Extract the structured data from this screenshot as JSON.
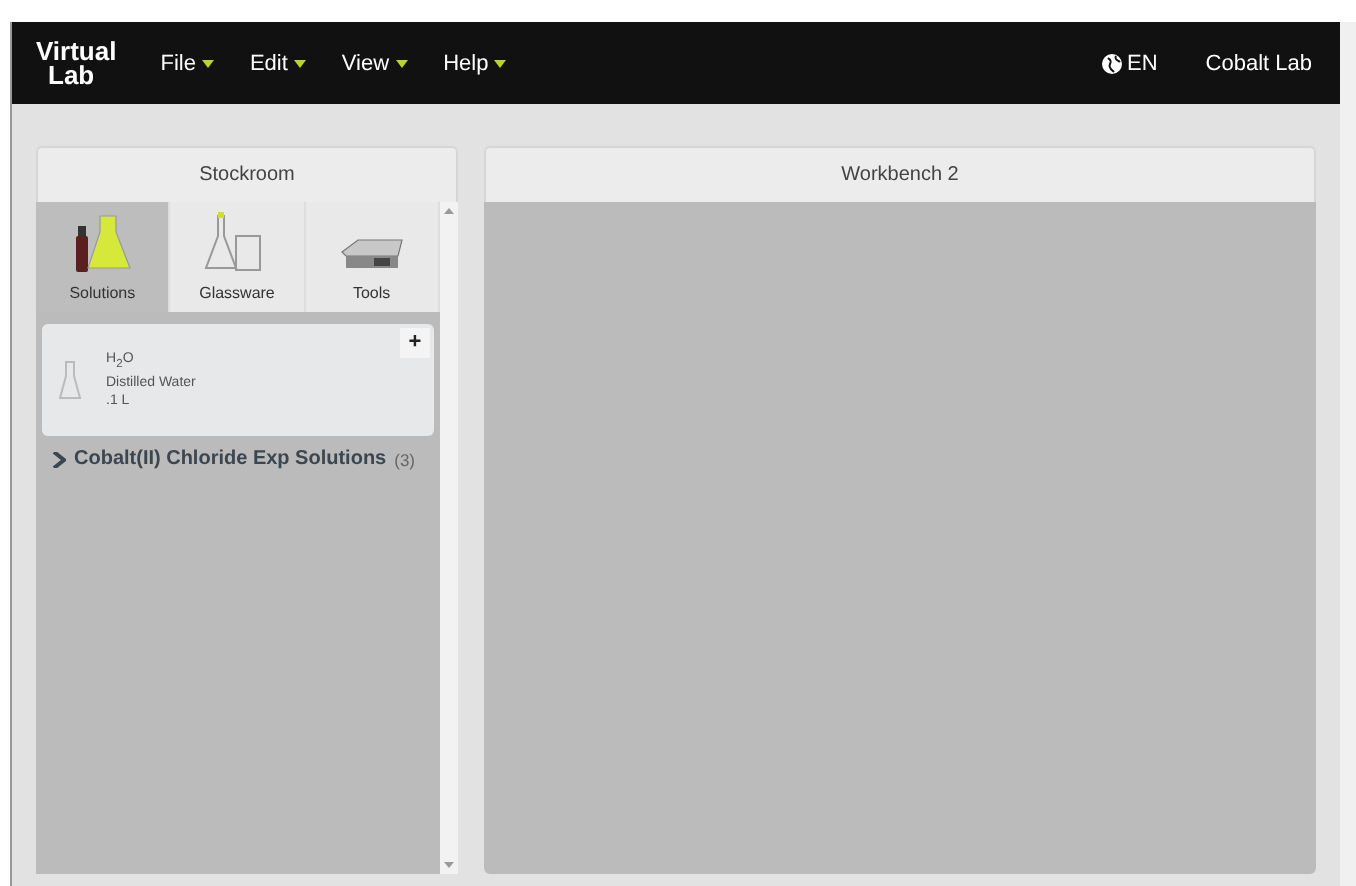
{
  "navbar": {
    "logo": [
      "Virtual",
      "Lab"
    ],
    "menus": [
      {
        "label": "File"
      },
      {
        "label": "Edit"
      },
      {
        "label": "View"
      },
      {
        "label": "Help"
      }
    ],
    "language": "EN",
    "user": "Cobalt Lab"
  },
  "stockroom": {
    "title": "Stockroom",
    "tabs": [
      {
        "label": "Solutions",
        "kind": "solutions",
        "selected": true
      },
      {
        "label": "Glassware",
        "kind": "glassware",
        "selected": false
      },
      {
        "label": "Tools",
        "kind": "tools",
        "selected": false
      }
    ],
    "items": [
      {
        "formula": "H$_{2}$O",
        "name": "Distilled Water",
        "amount": ".1 L",
        "add": "+"
      }
    ],
    "groups": [
      {
        "label": "Cobalt(II) Chloride Exp Solutions",
        "count": "(3)",
        "expanded": false
      }
    ]
  },
  "workbench": {
    "title": "Workbench 2"
  }
}
